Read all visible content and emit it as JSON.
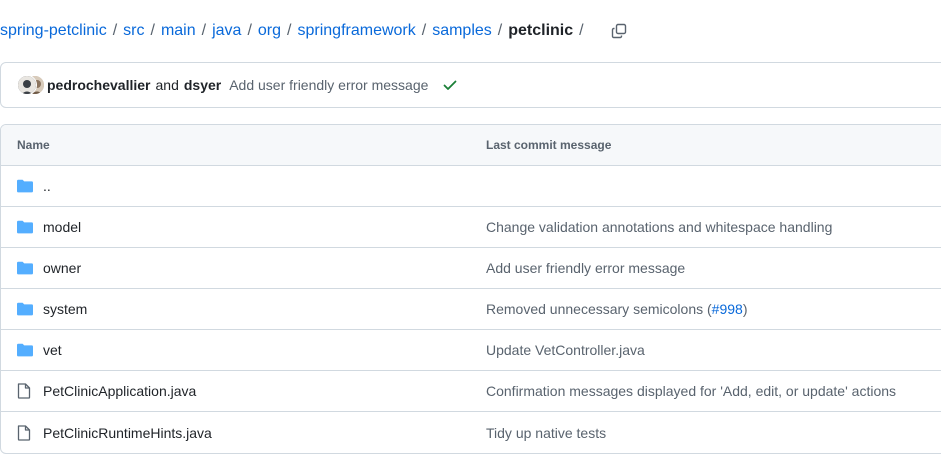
{
  "breadcrumb": {
    "items": [
      "spring-petclinic",
      "src",
      "main",
      "java",
      "org",
      "springframework",
      "samples"
    ],
    "current": "petclinic",
    "separator": "/",
    "copy_icon": "copy-icon"
  },
  "latest_commit": {
    "author1": "pedrochevallier",
    "and_text": "and",
    "author2": "dsyer",
    "message": "Add user friendly error message",
    "status_icon": "check-icon",
    "status_color": "#1a7f37"
  },
  "table": {
    "headers": {
      "name": "Name",
      "message": "Last commit message"
    },
    "rows": [
      {
        "type": "folder",
        "name": "..",
        "message": ""
      },
      {
        "type": "folder",
        "name": "model",
        "message": "Change validation annotations and whitespace handling"
      },
      {
        "type": "folder",
        "name": "owner",
        "message": "Add user friendly error message"
      },
      {
        "type": "folder",
        "name": "system",
        "message": "Removed unnecessary semicolons (",
        "link": "#998",
        "message_suffix": ")"
      },
      {
        "type": "folder",
        "name": "vet",
        "message": "Update VetController.java"
      },
      {
        "type": "file",
        "name": "PetClinicApplication.java",
        "message": "Confirmation messages displayed for 'Add, edit, or update' actions"
      },
      {
        "type": "file",
        "name": "PetClinicRuntimeHints.java",
        "message": "Tidy up native tests"
      }
    ]
  },
  "colors": {
    "link": "#0969da",
    "folder_icon": "#54aeff",
    "muted_text": "#59636e",
    "border": "#d1d9e0"
  }
}
